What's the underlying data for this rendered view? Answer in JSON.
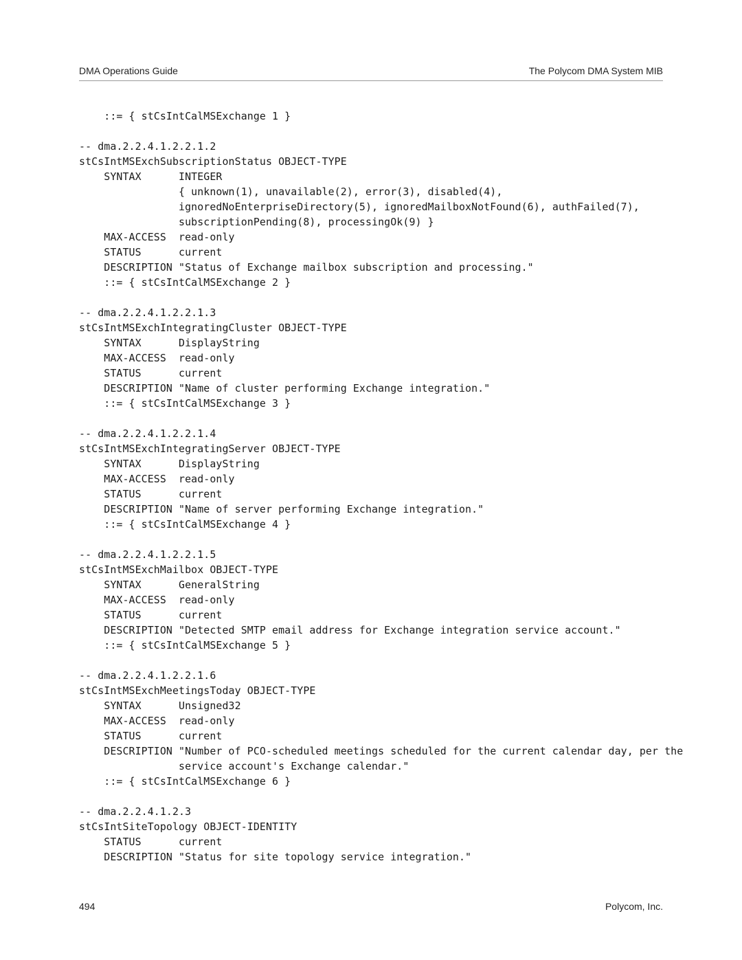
{
  "header": {
    "left": "DMA Operations Guide",
    "right": "The Polycom DMA System MIB"
  },
  "code": {
    "line0": "    ::= { stCsIntCalMSExchange 1 }",
    "blank0": "",
    "line1": "-- dma.2.2.4.1.2.2.1.2",
    "line2": "stCsIntMSExchSubscriptionStatus OBJECT-TYPE",
    "line3": "    SYNTAX      INTEGER",
    "line4": "                { unknown(1), unavailable(2), error(3), disabled(4),",
    "line5": "                ignoredNoEnterpriseDirectory(5), ignoredMailboxNotFound(6), authFailed(7),",
    "line6": "                subscriptionPending(8), processingOk(9) }",
    "line7": "    MAX-ACCESS  read-only",
    "line8": "    STATUS      current",
    "line9": "    DESCRIPTION \"Status of Exchange mailbox subscription and processing.\"",
    "line10": "    ::= { stCsIntCalMSExchange 2 }",
    "blank1": "",
    "line11": "-- dma.2.2.4.1.2.2.1.3",
    "line12": "stCsIntMSExchIntegratingCluster OBJECT-TYPE",
    "line13": "    SYNTAX      DisplayString",
    "line14": "    MAX-ACCESS  read-only",
    "line15": "    STATUS      current",
    "line16": "    DESCRIPTION \"Name of cluster performing Exchange integration.\"",
    "line17": "    ::= { stCsIntCalMSExchange 3 }",
    "blank2": "",
    "line18": "-- dma.2.2.4.1.2.2.1.4",
    "line19": "stCsIntMSExchIntegratingServer OBJECT-TYPE",
    "line20": "    SYNTAX      DisplayString",
    "line21": "    MAX-ACCESS  read-only",
    "line22": "    STATUS      current",
    "line23": "    DESCRIPTION \"Name of server performing Exchange integration.\"",
    "line24": "    ::= { stCsIntCalMSExchange 4 }",
    "blank3": "",
    "line25": "-- dma.2.2.4.1.2.2.1.5",
    "line26": "stCsIntMSExchMailbox OBJECT-TYPE",
    "line27": "    SYNTAX      GeneralString",
    "line28": "    MAX-ACCESS  read-only",
    "line29": "    STATUS      current",
    "line30": "    DESCRIPTION \"Detected SMTP email address for Exchange integration service account.\"",
    "line31": "    ::= { stCsIntCalMSExchange 5 }",
    "blank4": "",
    "line32": "-- dma.2.2.4.1.2.2.1.6",
    "line33": "stCsIntMSExchMeetingsToday OBJECT-TYPE",
    "line34": "    SYNTAX      Unsigned32",
    "line35": "    MAX-ACCESS  read-only",
    "line36": "    STATUS      current",
    "line37": "    DESCRIPTION \"Number of PCO-scheduled meetings scheduled for the current calendar day, per the",
    "line38": "                service account's Exchange calendar.\"",
    "line39": "    ::= { stCsIntCalMSExchange 6 }",
    "blank5": "",
    "line40": "-- dma.2.2.4.1.2.3",
    "line41": "stCsIntSiteTopology OBJECT-IDENTITY",
    "line42": "    STATUS      current",
    "line43": "    DESCRIPTION \"Status for site topology service integration.\""
  },
  "footer": {
    "page_number": "494",
    "company": "Polycom, Inc."
  }
}
